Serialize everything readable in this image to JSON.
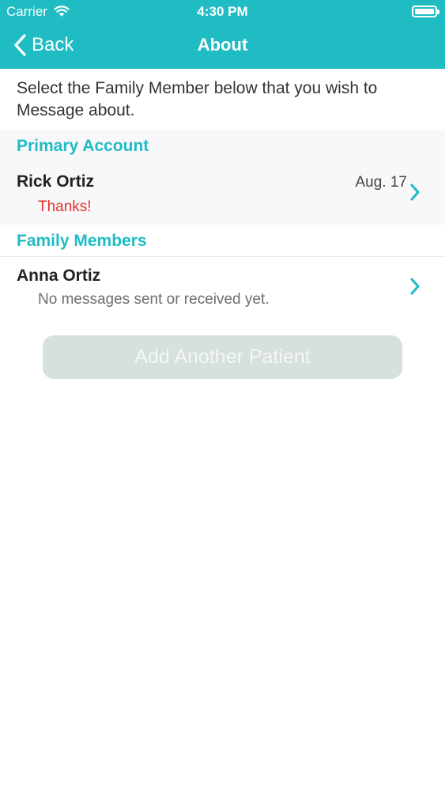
{
  "status_bar": {
    "carrier": "Carrier",
    "time": "4:30 PM"
  },
  "nav": {
    "back_label": "Back",
    "title": "About"
  },
  "instruction": "Select the Family Member below that you wish to Message about.",
  "primary_section": {
    "header": "Primary Account",
    "rows": [
      {
        "name": "Rick Ortiz",
        "subtitle": "Thanks!",
        "date": "Aug. 17"
      }
    ]
  },
  "family_section": {
    "header": "Family Members",
    "rows": [
      {
        "name": "Anna Ortiz",
        "subtitle": "No messages sent or received yet.",
        "date": ""
      }
    ]
  },
  "add_button": {
    "label": "Add Another Patient"
  },
  "colors": {
    "accent": "#1fbcc4",
    "section_background": "#f8f8fa",
    "unread_message": "#e0332e",
    "muted_text": "#6e6e73",
    "disabled_button": "#d6e0de"
  },
  "icons": {
    "wifi": "wifi-icon",
    "battery": "battery-icon",
    "back": "chevron-left-icon",
    "disclosure": "chevron-right-icon"
  }
}
